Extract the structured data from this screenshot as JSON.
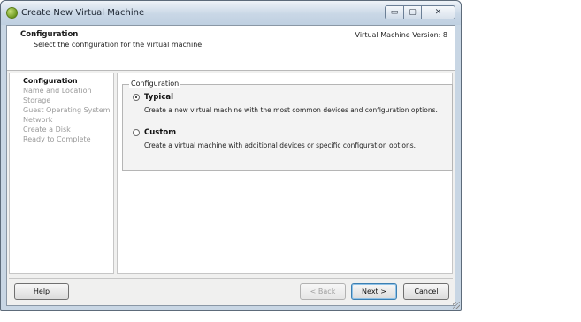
{
  "window": {
    "title": "Create New Virtual Machine",
    "controls": {
      "minimize": "▭",
      "maximize": "▢",
      "close": "✕"
    }
  },
  "header": {
    "title": "Configuration",
    "subtitle": "Select the configuration for the virtual machine",
    "version": "Virtual Machine Version: 8"
  },
  "steps": [
    {
      "label": "Configuration",
      "active": true
    },
    {
      "label": "Name and Location",
      "active": false
    },
    {
      "label": "Storage",
      "active": false
    },
    {
      "label": "Guest Operating System",
      "active": false
    },
    {
      "label": "Network",
      "active": false
    },
    {
      "label": "Create a Disk",
      "active": false
    },
    {
      "label": "Ready to Complete",
      "active": false
    }
  ],
  "config": {
    "group_label": "Configuration",
    "options": [
      {
        "label": "Typical",
        "description": "Create a new virtual machine with the most common devices and configuration options.",
        "selected": true
      },
      {
        "label": "Custom",
        "description": "Create a virtual machine with additional devices or specific configuration options.",
        "selected": false
      }
    ]
  },
  "buttons": {
    "help": "Help",
    "back": "< Back",
    "next": "Next >",
    "cancel": "Cancel"
  }
}
